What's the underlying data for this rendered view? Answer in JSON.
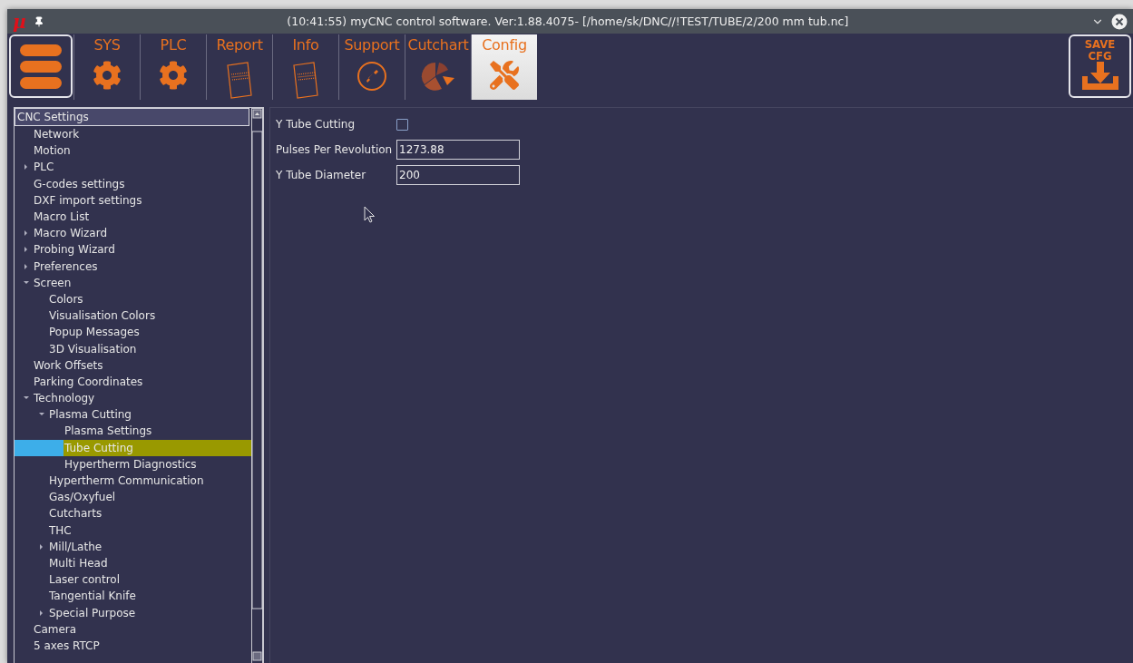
{
  "window": {
    "app_icon": "µ",
    "title": "(10:41:55) myCNC control software. Ver:1.88.4075- [/home/sk/DNC//!TEST/TUBE/2/200 mm tub.nc]"
  },
  "toolbar": {
    "tabs": [
      {
        "label": "SYS",
        "kind": "gear",
        "selected": false
      },
      {
        "label": "PLC",
        "kind": "gear",
        "selected": false
      },
      {
        "label": "Report",
        "kind": "document",
        "selected": false
      },
      {
        "label": "Info",
        "kind": "document",
        "selected": false
      },
      {
        "label": "Support",
        "kind": "phone",
        "selected": false
      },
      {
        "label": "Cutchart",
        "kind": "pie",
        "selected": false
      },
      {
        "label": "Config",
        "kind": "tools",
        "selected": true
      }
    ],
    "save_button": {
      "line_1": "SAVE",
      "line_2": "CFG"
    }
  },
  "tree": {
    "label": "CNC Settings",
    "children": [
      {
        "label": "Network",
        "selected": false
      },
      {
        "label": "Motion",
        "selected": false
      },
      {
        "label": "PLC",
        "selected": false,
        "expanded": false
      },
      {
        "label": "G-codes settings",
        "selected": false
      },
      {
        "label": "DXF import settings",
        "selected": false
      },
      {
        "label": "Macro List",
        "selected": false
      },
      {
        "label": "Macro Wizard",
        "selected": false,
        "expanded": false
      },
      {
        "label": "Probing Wizard",
        "selected": false,
        "expanded": false
      },
      {
        "label": "Preferences",
        "selected": false,
        "expanded": false
      },
      {
        "label": "Screen",
        "selected": false,
        "expanded": true,
        "children": [
          {
            "label": "Colors",
            "selected": false
          },
          {
            "label": "Visualisation Colors",
            "selected": false
          },
          {
            "label": "Popup Messages",
            "selected": false
          },
          {
            "label": "3D Visualisation",
            "selected": false
          }
        ]
      },
      {
        "label": "Work Offsets",
        "selected": false
      },
      {
        "label": "Parking Coordinates",
        "selected": false
      },
      {
        "label": "Technology",
        "selected": false,
        "expanded": true,
        "children": [
          {
            "label": "Plasma Cutting",
            "selected": false,
            "expanded": true,
            "children": [
              {
                "label": "Plasma Settings",
                "selected": false
              },
              {
                "label": "Tube Cutting",
                "selected": true
              },
              {
                "label": "Hypertherm Diagnostics",
                "selected": false
              }
            ]
          },
          {
            "label": "Hypertherm Communication",
            "selected": false
          },
          {
            "label": "Gas/Oxyfuel",
            "selected": false
          },
          {
            "label": "Cutcharts",
            "selected": false
          },
          {
            "label": "THC",
            "selected": false
          },
          {
            "label": "Mill/Lathe",
            "selected": false,
            "expanded": false
          },
          {
            "label": "Multi Head",
            "selected": false
          },
          {
            "label": "Laser control",
            "selected": false
          },
          {
            "label": "Tangential Knife",
            "selected": false
          },
          {
            "label": "Special Purpose",
            "selected": false,
            "expanded": false
          }
        ]
      },
      {
        "label": "Camera",
        "selected": false
      },
      {
        "label": "5 axes RTCP",
        "selected": false
      }
    ]
  },
  "settings": [
    {
      "kind": "checkbox",
      "label": "Y Tube Cutting",
      "checked": false
    },
    {
      "kind": "input",
      "label": "Pulses Per Revolution",
      "value": "1273.88"
    },
    {
      "kind": "input",
      "label": "Y Tube Diameter",
      "value": "200"
    }
  ]
}
